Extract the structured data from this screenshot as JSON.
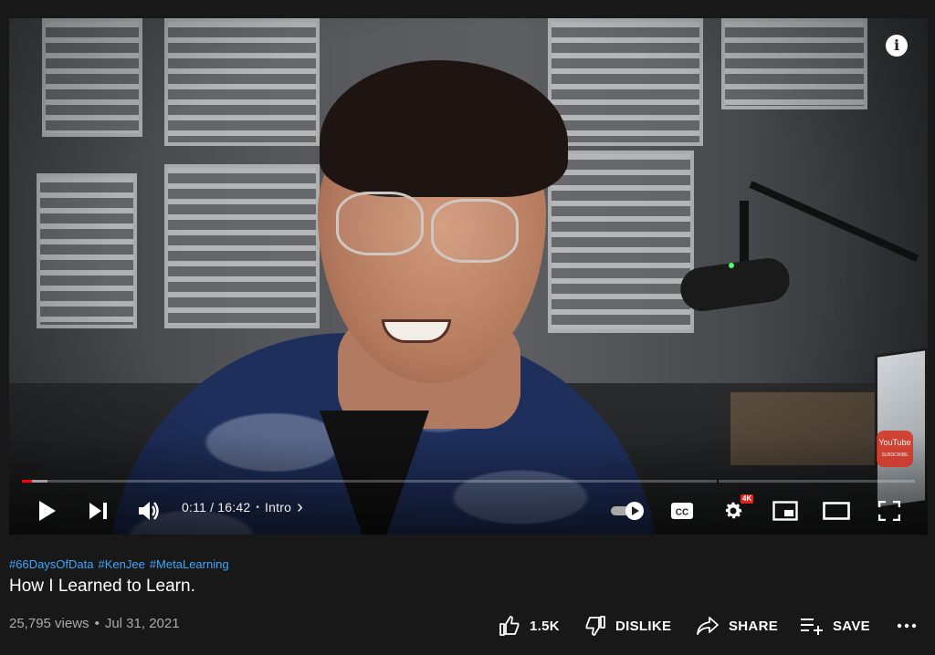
{
  "player": {
    "info_icon": "info-icon",
    "watermark": {
      "line1": "You",
      "line2": "Tube",
      "line3": "SUBSCRIBE"
    },
    "progress": {
      "played_fraction": 0.011,
      "buffered_fraction": 0.029
    },
    "time": {
      "current": "0:11",
      "separator": " / ",
      "duration": "16:42"
    },
    "chapter": {
      "label": "Intro",
      "chevron": "›"
    },
    "quality_badge": "4K",
    "icons": {
      "play": "play-icon",
      "next": "next-icon",
      "volume": "volume-icon",
      "autoplay": "autoplay-toggle-icon",
      "captions": "cc-icon",
      "settings": "gear-icon",
      "miniplayer": "miniplayer-icon",
      "theater": "theater-icon",
      "fullscreen": "fullscreen-icon"
    },
    "captions_label": "CC"
  },
  "video": {
    "hashtags": [
      "#66DaysOfData",
      "#KenJee",
      "#MetaLearning"
    ],
    "title": "How I Learned to Learn.",
    "views": "25,795 views",
    "separator": "•",
    "date": "Jul 31, 2021"
  },
  "actions": {
    "like": {
      "label": "1.5K",
      "icon": "thumbs-up-icon"
    },
    "dislike": {
      "label": "DISLIKE",
      "icon": "thumbs-down-icon"
    },
    "share": {
      "label": "SHARE",
      "icon": "share-icon"
    },
    "save": {
      "label": "SAVE",
      "icon": "add-to-playlist-icon"
    },
    "more": {
      "icon": "more-horizontal-icon"
    }
  },
  "colors": {
    "background": "#181818",
    "hashtag": "#3ea6ff",
    "progress": "#ff0000",
    "muted_text": "#aaaaaa"
  }
}
